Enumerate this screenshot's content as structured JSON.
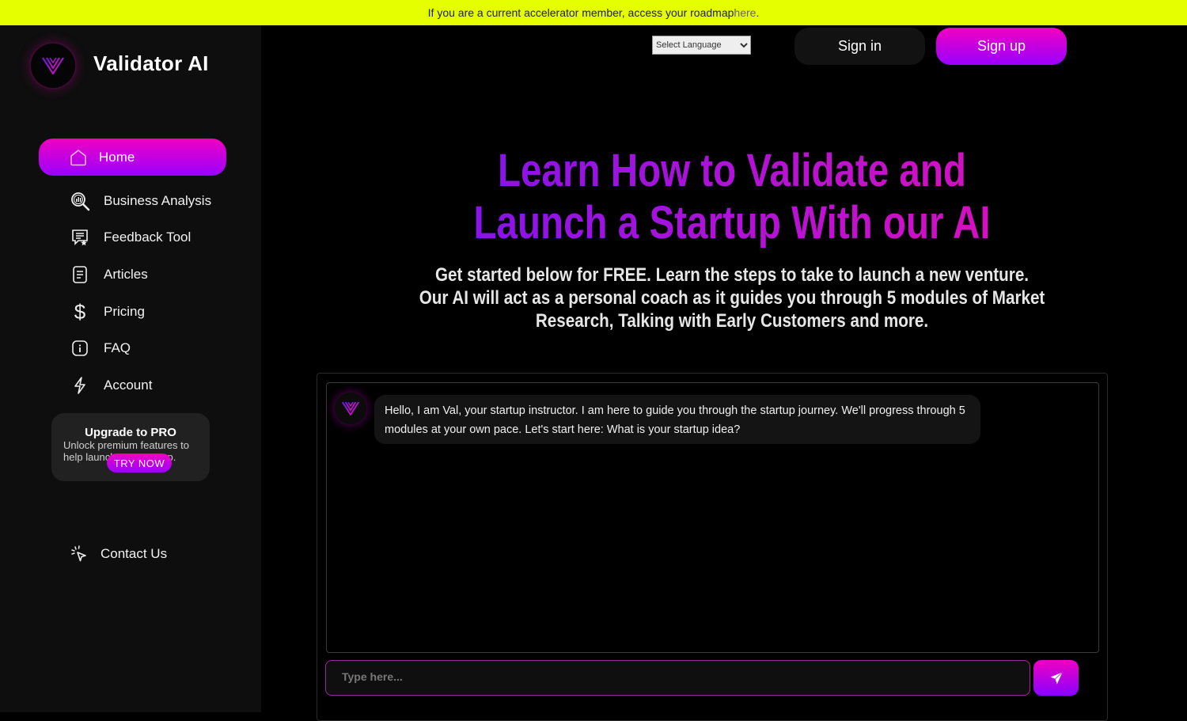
{
  "banner": {
    "text": "If you are a current accelerator member, access your roadmap ",
    "link": "here",
    "suffix": "."
  },
  "brand": {
    "name": "Validator AI",
    "logo_icon": "v-logo-icon"
  },
  "sidebar": {
    "items": [
      {
        "label": "Home",
        "icon": "home-icon",
        "active": true
      },
      {
        "label": "Business Analysis",
        "icon": "magnifier-chart-icon"
      },
      {
        "label": "Feedback Tool",
        "icon": "feedback-chat-icon"
      },
      {
        "label": "Articles",
        "icon": "document-icon"
      },
      {
        "label": "Pricing",
        "icon": "dollar-icon"
      },
      {
        "label": "FAQ",
        "icon": "info-icon"
      },
      {
        "label": "Account",
        "icon": "lightning-icon"
      }
    ],
    "promo": {
      "title": "Upgrade to PRO",
      "text": "Unlock premium features to help launch your startup.",
      "button": "TRY NOW"
    },
    "contact": {
      "label": "Contact Us",
      "icon": "pointer-click-icon"
    }
  },
  "header": {
    "language_select": "Select Language",
    "sign_in": "Sign in",
    "sign_up": "Sign up"
  },
  "hero": {
    "title_line1": "Learn How to Validate and",
    "title_line2": "Launch a Startup With our AI",
    "subtitle_line1": "Get started below for FREE. Learn the steps to take to launch a new venture.",
    "subtitle_line2": "Our AI will act as a personal coach as it guides you through 5 modules of Market",
    "subtitle_line3": "Research, Talking with Early Customers and more."
  },
  "chat": {
    "messages": [
      {
        "sender": "bot",
        "text": "Hello, I am Val, your startup instructor.  I am here to guide you through the startup journey.  We'll progress through 5 modules at your own pace. Let's start here:  What is your startup idea?"
      }
    ],
    "input_placeholder": "Type here...",
    "input_value": "",
    "send_icon": "send-icon"
  },
  "colors": {
    "banner": "#e5ff00",
    "accent_pink": "#f000c0",
    "accent_purple": "#9a00ff",
    "sidebar_bg": "#0e0e0e"
  }
}
